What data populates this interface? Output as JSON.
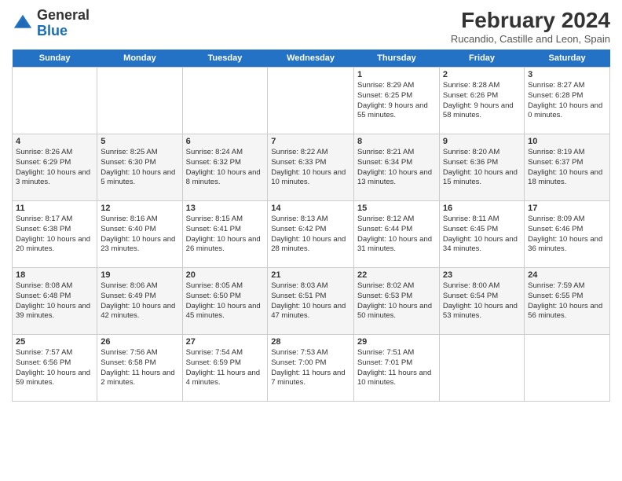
{
  "header": {
    "logo_general": "General",
    "logo_blue": "Blue",
    "month_year": "February 2024",
    "location": "Rucandio, Castille and Leon, Spain"
  },
  "days_of_week": [
    "Sunday",
    "Monday",
    "Tuesday",
    "Wednesday",
    "Thursday",
    "Friday",
    "Saturday"
  ],
  "weeks": [
    [
      {
        "day": "",
        "content": ""
      },
      {
        "day": "",
        "content": ""
      },
      {
        "day": "",
        "content": ""
      },
      {
        "day": "",
        "content": ""
      },
      {
        "day": "1",
        "content": "Sunrise: 8:29 AM\nSunset: 6:25 PM\nDaylight: 9 hours and 55 minutes."
      },
      {
        "day": "2",
        "content": "Sunrise: 8:28 AM\nSunset: 6:26 PM\nDaylight: 9 hours and 58 minutes."
      },
      {
        "day": "3",
        "content": "Sunrise: 8:27 AM\nSunset: 6:28 PM\nDaylight: 10 hours and 0 minutes."
      }
    ],
    [
      {
        "day": "4",
        "content": "Sunrise: 8:26 AM\nSunset: 6:29 PM\nDaylight: 10 hours and 3 minutes."
      },
      {
        "day": "5",
        "content": "Sunrise: 8:25 AM\nSunset: 6:30 PM\nDaylight: 10 hours and 5 minutes."
      },
      {
        "day": "6",
        "content": "Sunrise: 8:24 AM\nSunset: 6:32 PM\nDaylight: 10 hours and 8 minutes."
      },
      {
        "day": "7",
        "content": "Sunrise: 8:22 AM\nSunset: 6:33 PM\nDaylight: 10 hours and 10 minutes."
      },
      {
        "day": "8",
        "content": "Sunrise: 8:21 AM\nSunset: 6:34 PM\nDaylight: 10 hours and 13 minutes."
      },
      {
        "day": "9",
        "content": "Sunrise: 8:20 AM\nSunset: 6:36 PM\nDaylight: 10 hours and 15 minutes."
      },
      {
        "day": "10",
        "content": "Sunrise: 8:19 AM\nSunset: 6:37 PM\nDaylight: 10 hours and 18 minutes."
      }
    ],
    [
      {
        "day": "11",
        "content": "Sunrise: 8:17 AM\nSunset: 6:38 PM\nDaylight: 10 hours and 20 minutes."
      },
      {
        "day": "12",
        "content": "Sunrise: 8:16 AM\nSunset: 6:40 PM\nDaylight: 10 hours and 23 minutes."
      },
      {
        "day": "13",
        "content": "Sunrise: 8:15 AM\nSunset: 6:41 PM\nDaylight: 10 hours and 26 minutes."
      },
      {
        "day": "14",
        "content": "Sunrise: 8:13 AM\nSunset: 6:42 PM\nDaylight: 10 hours and 28 minutes."
      },
      {
        "day": "15",
        "content": "Sunrise: 8:12 AM\nSunset: 6:44 PM\nDaylight: 10 hours and 31 minutes."
      },
      {
        "day": "16",
        "content": "Sunrise: 8:11 AM\nSunset: 6:45 PM\nDaylight: 10 hours and 34 minutes."
      },
      {
        "day": "17",
        "content": "Sunrise: 8:09 AM\nSunset: 6:46 PM\nDaylight: 10 hours and 36 minutes."
      }
    ],
    [
      {
        "day": "18",
        "content": "Sunrise: 8:08 AM\nSunset: 6:48 PM\nDaylight: 10 hours and 39 minutes."
      },
      {
        "day": "19",
        "content": "Sunrise: 8:06 AM\nSunset: 6:49 PM\nDaylight: 10 hours and 42 minutes."
      },
      {
        "day": "20",
        "content": "Sunrise: 8:05 AM\nSunset: 6:50 PM\nDaylight: 10 hours and 45 minutes."
      },
      {
        "day": "21",
        "content": "Sunrise: 8:03 AM\nSunset: 6:51 PM\nDaylight: 10 hours and 47 minutes."
      },
      {
        "day": "22",
        "content": "Sunrise: 8:02 AM\nSunset: 6:53 PM\nDaylight: 10 hours and 50 minutes."
      },
      {
        "day": "23",
        "content": "Sunrise: 8:00 AM\nSunset: 6:54 PM\nDaylight: 10 hours and 53 minutes."
      },
      {
        "day": "24",
        "content": "Sunrise: 7:59 AM\nSunset: 6:55 PM\nDaylight: 10 hours and 56 minutes."
      }
    ],
    [
      {
        "day": "25",
        "content": "Sunrise: 7:57 AM\nSunset: 6:56 PM\nDaylight: 10 hours and 59 minutes."
      },
      {
        "day": "26",
        "content": "Sunrise: 7:56 AM\nSunset: 6:58 PM\nDaylight: 11 hours and 2 minutes."
      },
      {
        "day": "27",
        "content": "Sunrise: 7:54 AM\nSunset: 6:59 PM\nDaylight: 11 hours and 4 minutes."
      },
      {
        "day": "28",
        "content": "Sunrise: 7:53 AM\nSunset: 7:00 PM\nDaylight: 11 hours and 7 minutes."
      },
      {
        "day": "29",
        "content": "Sunrise: 7:51 AM\nSunset: 7:01 PM\nDaylight: 11 hours and 10 minutes."
      },
      {
        "day": "",
        "content": ""
      },
      {
        "day": "",
        "content": ""
      }
    ]
  ]
}
